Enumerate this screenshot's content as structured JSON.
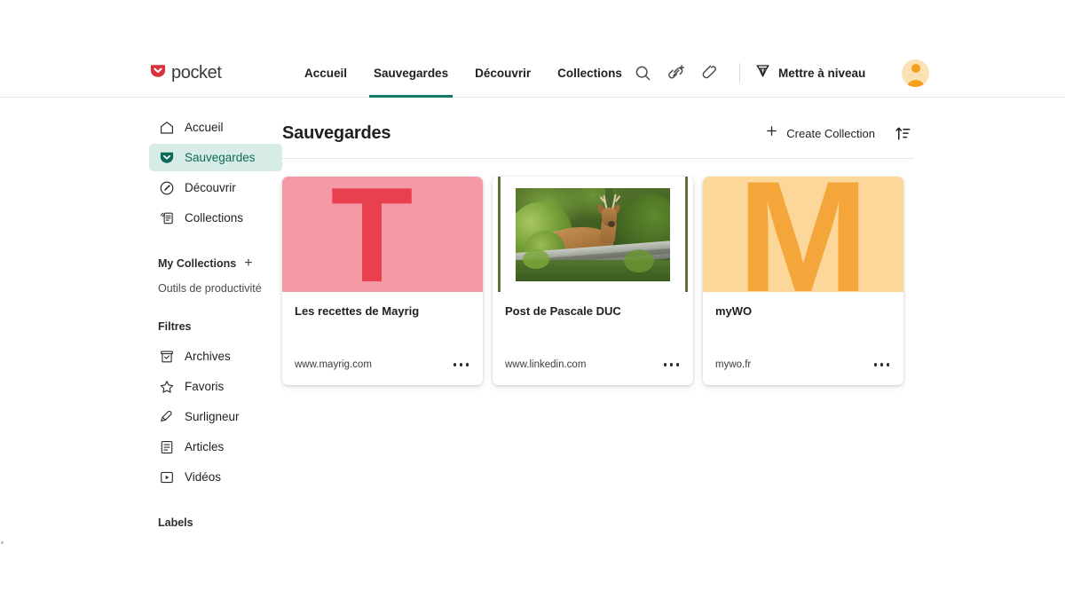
{
  "brand": {
    "name": "pocket",
    "logo_icon": "pocket-shield-icon",
    "logo_color": "#d7323e",
    "accent_color": "#107a68"
  },
  "header": {
    "nav": [
      {
        "label": "Accueil",
        "active": false
      },
      {
        "label": "Sauvegardes",
        "active": true
      },
      {
        "label": "Découvrir",
        "active": false
      },
      {
        "label": "Collections",
        "active": false
      }
    ],
    "actions": [
      {
        "icon": "search-icon",
        "label": "Rechercher"
      },
      {
        "icon": "add-link-icon",
        "label": "Ajouter un lien"
      },
      {
        "icon": "pencil-icon",
        "label": "Modifier"
      }
    ],
    "upgrade": {
      "icon": "gem-icon",
      "label": "Mettre à niveau"
    },
    "avatar": {
      "icon": "user-avatar-icon",
      "background": "#fbe2b4",
      "foreground": "#f6a020"
    }
  },
  "sidebar": {
    "items": [
      {
        "label": "Accueil",
        "icon": "home-icon",
        "active": false
      },
      {
        "label": "Sauvegardes",
        "icon": "shield-check-icon",
        "active": true
      },
      {
        "label": "Découvrir",
        "icon": "compass-icon",
        "active": false
      },
      {
        "label": "Collections",
        "icon": "cards-stack-icon",
        "active": false
      }
    ],
    "my_collections": {
      "title": "My Collections",
      "add_icon": "plus-icon",
      "items": [
        {
          "label": "Outils de productivité"
        }
      ]
    },
    "filters": {
      "title": "Filtres",
      "items": [
        {
          "label": "Archives",
          "icon": "archive-box-icon"
        },
        {
          "label": "Favoris",
          "icon": "star-icon"
        },
        {
          "label": "Surligneur",
          "icon": "highlighter-icon"
        },
        {
          "label": "Articles",
          "icon": "article-icon"
        },
        {
          "label": "Vidéos",
          "icon": "video-play-icon"
        }
      ]
    },
    "labels": {
      "title": "Labels"
    }
  },
  "main": {
    "title": "Sauvegardes",
    "create_collection": {
      "label": "Create Collection",
      "icon": "plus-icon"
    },
    "sort": {
      "icon": "sort-ascending-icon"
    },
    "cards": [
      {
        "title": "Les recettes de Mayrig",
        "url": "www.mayrig.com",
        "thumb_type": "letter",
        "letter": "T",
        "bg_color": "#f59aa5",
        "fg_color": "#e8404f",
        "menu_icon": "more-options-icon"
      },
      {
        "title": "Post de Pascale DUC",
        "url": "www.linkedin.com",
        "thumb_type": "photo",
        "photo_alt": "Chevreuil derrière un tronc d'arbre en forêt",
        "edge_color": "#5d7330",
        "menu_icon": "more-options-icon"
      },
      {
        "title": "myWO",
        "url": "mywo.fr",
        "thumb_type": "letter",
        "letter": "M",
        "bg_color": "#fbd79a",
        "fg_color": "#f5a63a",
        "menu_icon": "more-options-icon"
      }
    ]
  }
}
